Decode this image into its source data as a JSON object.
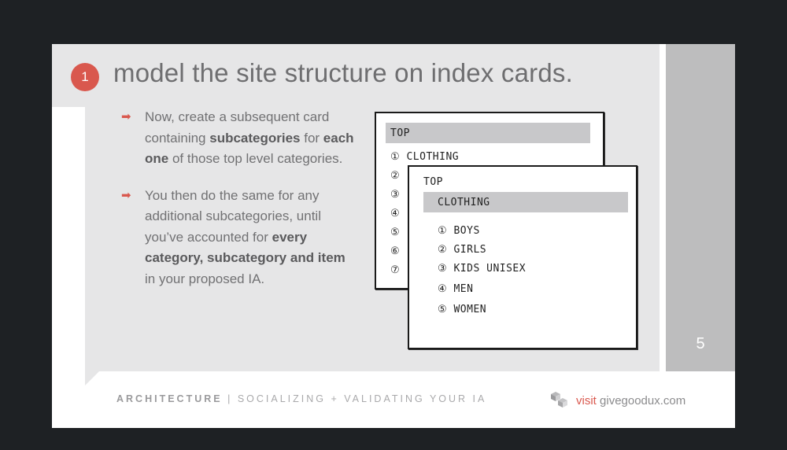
{
  "slide": {
    "step_number": "1",
    "title": "model the site structure on index cards.",
    "page_number": "5"
  },
  "bullets": [
    {
      "parts": [
        {
          "text": "Now, create a subsequent card containing ",
          "bold": false
        },
        {
          "text": "subcategories",
          "bold": true
        },
        {
          "text": " for ",
          "bold": false
        },
        {
          "text": "each one",
          "bold": true
        },
        {
          "text": " of those top level categories.",
          "bold": false
        }
      ]
    },
    {
      "parts": [
        {
          "text": "You then do the same for any additional subcategories, until you’ve accounted for ",
          "bold": false
        },
        {
          "text": "every category, subcategory and item",
          "bold": true
        },
        {
          "text": " in your proposed IA.",
          "bold": false
        }
      ]
    }
  ],
  "card_back": {
    "header": "TOP",
    "items": [
      "① CLOTHING",
      "②",
      "③",
      "④",
      "⑤",
      "⑥",
      "⑦"
    ]
  },
  "card_front": {
    "header": "TOP",
    "highlight": "CLOTHING",
    "items": [
      "① BOYS",
      "② GIRLS",
      "③ KIDS UNISEX",
      "④ MEN",
      "⑤ WOMEN"
    ]
  },
  "footer": {
    "section": "ARCHITECTURE",
    "separator": "|",
    "subtitle": "SOCIALIZING + VALIDATING YOUR IA",
    "visit_label": "visit",
    "site": "givegoodux.com"
  },
  "colors": {
    "accent": "#d9584e",
    "content_bg": "#e6e6e7",
    "side_bar": "#bdbdbe"
  }
}
